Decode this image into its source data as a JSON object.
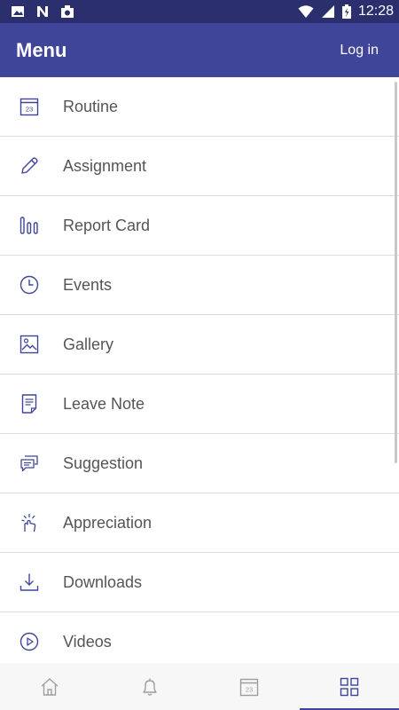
{
  "status_bar": {
    "time": "12:28"
  },
  "app_bar": {
    "title": "Menu",
    "login_label": "Log in"
  },
  "menu": {
    "items": [
      {
        "label": "Routine",
        "icon": "calendar-icon",
        "calendar_day": "23"
      },
      {
        "label": "Assignment",
        "icon": "pencil-icon"
      },
      {
        "label": "Report Card",
        "icon": "bar-chart-icon"
      },
      {
        "label": "Events",
        "icon": "clock-icon"
      },
      {
        "label": "Gallery",
        "icon": "image-icon"
      },
      {
        "label": "Leave Note",
        "icon": "note-icon"
      },
      {
        "label": "Suggestion",
        "icon": "chat-icon"
      },
      {
        "label": "Appreciation",
        "icon": "clap-icon"
      },
      {
        "label": "Downloads",
        "icon": "download-icon"
      },
      {
        "label": "Videos",
        "icon": "play-icon"
      }
    ]
  },
  "bottom_nav": {
    "items": [
      {
        "icon": "home-icon"
      },
      {
        "icon": "bell-icon"
      },
      {
        "icon": "calendar-icon",
        "calendar_day": "23"
      },
      {
        "icon": "grid-icon",
        "active": true
      }
    ]
  },
  "colors": {
    "accent": "#3f4599",
    "status_bar": "#2b2f6e",
    "text": "#555555"
  }
}
